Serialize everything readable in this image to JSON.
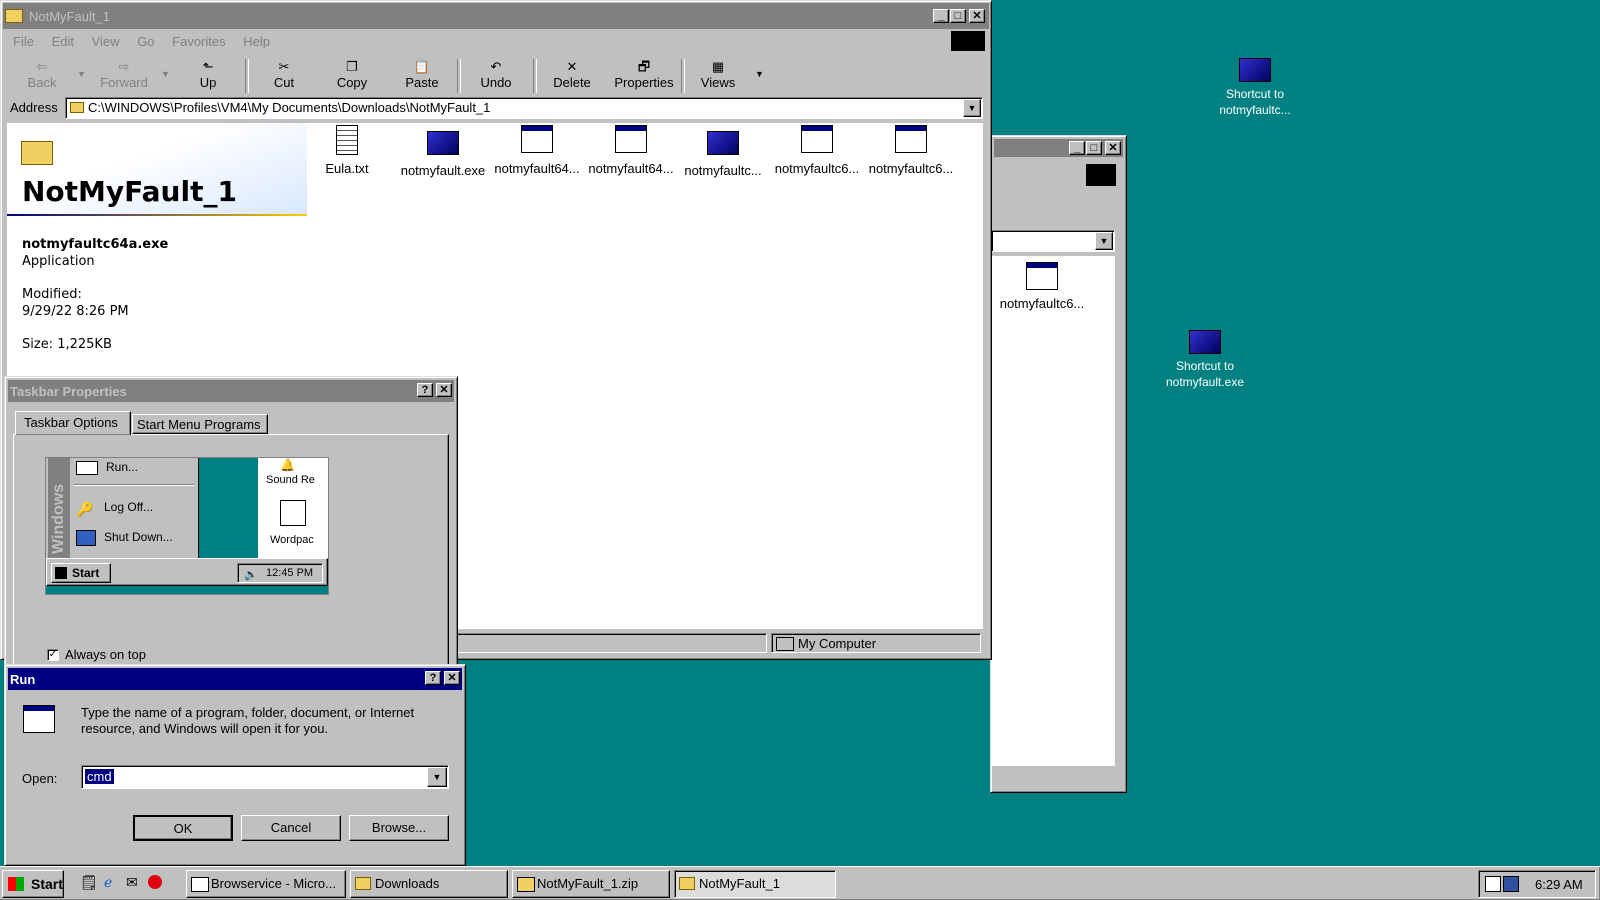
{
  "explorer": {
    "title": "NotMyFault_1",
    "menu": [
      "File",
      "Edit",
      "View",
      "Go",
      "Favorites",
      "Help"
    ],
    "toolbar": {
      "back": "Back",
      "forward": "Forward",
      "up": "Up",
      "cut": "Cut",
      "copy": "Copy",
      "paste": "Paste",
      "undo": "Undo",
      "delete": "Delete",
      "properties": "Properties",
      "views": "Views"
    },
    "address_label": "Address",
    "address": "C:\\WINDOWS\\Profiles\\VM4\\My Documents\\Downloads\\NotMyFault_1",
    "folder_heading": "NotMyFault_1",
    "details": {
      "name": "notmyfaultc64a.exe",
      "type": "Application",
      "modified_label": "Modified:",
      "modified": "9/29/22 8:26 PM",
      "size": "Size: 1,225KB"
    },
    "files": [
      "Eula.txt",
      "notmyfault.exe",
      "notmyfault64...",
      "notmyfault64...",
      "notmyfaultc...",
      "notmyfaultc6...",
      "notmyfaultc6..."
    ],
    "status": "My Computer"
  },
  "back_window": {
    "file": "notmyfaultc6..."
  },
  "desktop": {
    "icon1": {
      "line1": "Shortcut to",
      "line2": "notmyfaultc..."
    },
    "icon2": {
      "line1": "Shortcut to",
      "line2": "notmyfault.exe"
    }
  },
  "taskbar_props": {
    "title": "Taskbar Properties",
    "tabs": [
      "Taskbar Options",
      "Start Menu Programs"
    ],
    "preview": {
      "sidebar": "Windows",
      "run": "Run...",
      "logoff": "Log Off...",
      "shutdown": "Shut Down...",
      "sound": "Sound Re",
      "wordpad": "Wordpac",
      "start": "Start",
      "time": "12:45 PM"
    },
    "always_on_top": "Always on top"
  },
  "run": {
    "title": "Run",
    "description": "Type the name of a program, folder, document, or Internet resource, and Windows will open it for you.",
    "open_label": "Open:",
    "value": "cmd",
    "ok": "OK",
    "cancel": "Cancel",
    "browse": "Browse..."
  },
  "taskbar": {
    "start": "Start",
    "tasks": [
      "Browservice - Micro...",
      "Downloads",
      "NotMyFault_1.zip",
      "NotMyFault_1"
    ],
    "clock": "6:29 AM"
  }
}
